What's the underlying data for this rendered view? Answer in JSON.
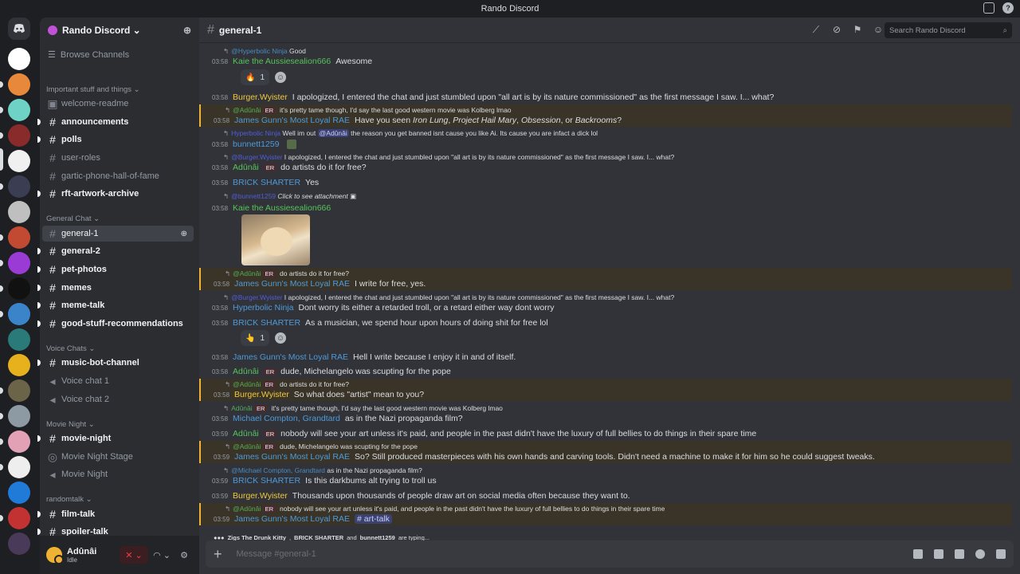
{
  "window": {
    "title": "Rando Discord"
  },
  "server": {
    "name": "Rando Discord ⌄"
  },
  "sidebar": {
    "browse": "Browse Channels",
    "categories": [
      {
        "label": "Important stuff and things ⌄"
      },
      {
        "label": "General Chat ⌄"
      },
      {
        "label": "Voice Chats ⌄"
      },
      {
        "label": "Movie Night ⌄"
      },
      {
        "label": "randomtalk ⌄"
      }
    ],
    "channels": [
      {
        "label": "welcome-readme"
      },
      {
        "label": "announcements"
      },
      {
        "label": "polls"
      },
      {
        "label": "user-roles"
      },
      {
        "label": "gartic-phone-hall-of-fame"
      },
      {
        "label": "rft-artwork-archive"
      },
      {
        "label": "general-1"
      },
      {
        "label": "general-2"
      },
      {
        "label": "pet-photos"
      },
      {
        "label": "memes"
      },
      {
        "label": "meme-talk"
      },
      {
        "label": "good-stuff-recommendations"
      },
      {
        "label": "music-bot-channel"
      },
      {
        "label": "Voice chat 1"
      },
      {
        "label": "Voice chat 2"
      },
      {
        "label": "movie-night"
      },
      {
        "label": "Movie Night Stage"
      },
      {
        "label": "Movie Night"
      },
      {
        "label": "film-talk"
      },
      {
        "label": "spoiler-talk"
      }
    ]
  },
  "user": {
    "name": "Adûnâi",
    "status": "Idle"
  },
  "channel": {
    "name": "general-1",
    "search_placeholder": "Search Rando Discord"
  },
  "messages": [
    {
      "reply_author": "@Hyperbolic Ninja",
      "reply_text": "Good",
      "time": "03:58",
      "author": "Kaie the Aussiesealion666",
      "text": "Awesome"
    },
    {
      "reaction_emoji": "🔥",
      "reaction_count": "1"
    },
    {
      "time": "03:58",
      "author": "Burger.Wyister",
      "text": "I apologized, I entered the chat and just stumbled upon \"all art is by its nature commissioned\" as the first message I saw. I... what?"
    },
    {
      "reply_author": "@Adûnâi",
      "reply_tag": "ER",
      "reply_text": "it's pretty tame though, I'd say the last good western movie was Kolberg lmao",
      "time": "03:58",
      "author": "James Gunn's Most Loyal RAE",
      "text_a": "Have you seen ",
      "i1": "Iron Lung",
      "s1": ", ",
      "i2": "Project Hail Mary",
      "s2": ", ",
      "i3": "Obsession",
      "s3": ", or ",
      "i4": "Backrooms",
      "s4": "?"
    },
    {
      "reply_author": "Hyperbolic Ninja",
      "reply_text_a": "Well im out ",
      "reply_mention": "@Adûnâi",
      "reply_text_b": " the reason you get banned isnt cause you like Ai. Its cause you are infact a dick lol",
      "time": "03:58",
      "author": "bunnett1259"
    },
    {
      "reply_author": "@Burger.Wyister",
      "reply_text": "I apologized, I entered the chat and just stumbled upon \"all art is by its nature commissioned\" as the first message I saw. I... what?",
      "time": "03:58",
      "author": "Adûnâi",
      "tag": "ER",
      "text": "do artists do it for free?"
    },
    {
      "time": "03:58",
      "author": "BRICK SHARTER",
      "text": "Yes"
    },
    {
      "reply_author": "@bunnett1259",
      "reply_text": "Click to see attachment",
      "time": "03:58",
      "author": "Kaie the Aussiesealion666"
    },
    {
      "reply_author": "@Adûnâi",
      "reply_tag": "ER",
      "reply_text": "do artists do it for free?",
      "time": "03:58",
      "author": "James Gunn's Most Loyal RAE",
      "text": "I write for free, yes."
    },
    {
      "reply_author": "@Burger.Wyister",
      "reply_text": "I apologized, I entered the chat and just stumbled upon \"all art is by its nature commissioned\" as the first message I saw. I... what?",
      "time": "03:58",
      "author": "Hyperbolic Ninja",
      "text": "Dont worry its either a retarded troll, or a retard either way dont worry"
    },
    {
      "time": "03:58",
      "author": "BRICK SHARTER",
      "text": "As a musician, we spend hour upon hours of doing shit for free lol"
    },
    {
      "reaction_emoji": "👆",
      "reaction_count": "1"
    },
    {
      "time": "03:58",
      "author": "James Gunn's Most Loyal RAE",
      "text": "Hell I write because I enjoy it in and of itself."
    },
    {
      "time": "03:58",
      "author": "Adûnâi",
      "tag": "ER",
      "text": "dude, Michelangelo was scupting for the pope"
    },
    {
      "reply_author": "@Adûnâi",
      "reply_tag": "ER",
      "reply_text": "do artists do it for free?",
      "time": "03:58",
      "author": "Burger.Wyister",
      "text": "So what does \"artist\" mean to you?"
    },
    {
      "reply_author": "Adûnâi",
      "reply_tag": "ER",
      "reply_text": "it's pretty tame though, I'd say the last good western movie was Kolberg lmao",
      "time": "03:58",
      "author": "Michael Compton, Grandtard",
      "text": "as in the Nazi propaganda film?"
    },
    {
      "time": "03:59",
      "author": "Adûnâi",
      "tag": "ER",
      "text": "nobody will see your art unless it's paid, and people in the past didn't have the luxury of full bellies to do things in their spare time"
    },
    {
      "reply_author": "@Adûnâi",
      "reply_tag": "ER",
      "reply_text": "dude, Michelangelo was scupting for the pope",
      "time": "03:59",
      "author": "James Gunn's Most Loyal RAE",
      "text": "So? Still produced masterpieces with his own hands and carving tools. Didn't need a machine to make it for him so he could suggest tweaks."
    },
    {
      "reply_author": "@Michael Compton, Grandtard",
      "reply_text": "as in the Nazi propaganda film?",
      "time": "03:59",
      "author": "BRICK SHARTER",
      "text": "Is this darkbums alt trying to troll us"
    },
    {
      "time": "03:59",
      "author": "Burger.Wyister",
      "text": "Thousands upon thousands of people draw art on social media often because they want to."
    },
    {
      "reply_author": "@Adûnâi",
      "reply_tag": "ER",
      "reply_text": "nobody will see your art unless it's paid, and people in the past didn't have the luxury of full bellies to do things in their spare time",
      "time": "03:59",
      "author": "James Gunn's Most Loyal RAE",
      "text": "# art-talk"
    }
  ],
  "typing": {
    "u1": "Zigs The Drunk Kitty",
    "sep1": ",",
    "u2": "BRICK SHARTER",
    "sep2": "and",
    "u3": "bunnett1259",
    "suffix": "are typing..."
  },
  "composer": {
    "placeholder": "Message #general-1"
  },
  "icons": [
    "discord-logo-icon",
    "hash-icon",
    "threads-icon",
    "mute-icon",
    "pin-icon",
    "members-icon",
    "search-icon",
    "inbox-icon",
    "help-icon",
    "plus-icon",
    "gift-icon",
    "gif-icon",
    "sticker-icon",
    "emoji-icon",
    "apps-icon",
    "settings-icon",
    "headphones-icon",
    "mic-muted-icon",
    "add-member-icon"
  ]
}
